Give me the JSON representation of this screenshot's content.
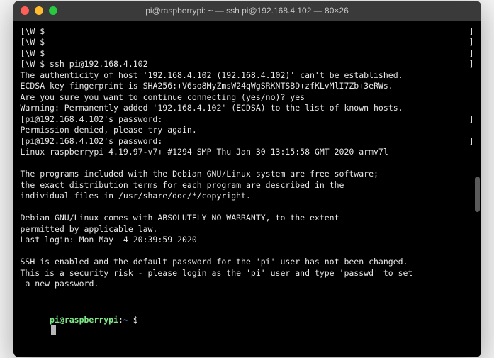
{
  "window": {
    "title": "pi@raspberrypi: ~ — ssh pi@192.168.4.102 — 80×26"
  },
  "lines": {
    "l0": "[\\W $",
    "l0r": "]",
    "l1": "[\\W $",
    "l1r": "]",
    "l2": "[\\W $",
    "l2r": "]",
    "l3": "[\\W $ ssh pi@192.168.4.102",
    "l3r": "]",
    "l4": "The authenticity of host '192.168.4.102 (192.168.4.102)' can't be established.",
    "l5": "ECDSA key fingerprint is SHA256:+V6so8MyZmsW24qWgSRKNTSBD+zfKLvMlI7Zb+3eRWs.",
    "l6": "Are you sure you want to continue connecting (yes/no)? yes",
    "l7": "Warning: Permanently added '192.168.4.102' (ECDSA) to the list of known hosts.",
    "l8": "[pi@192.168.4.102's password:",
    "l8r": "]",
    "l9": "Permission denied, please try again.",
    "l10": "[pi@192.168.4.102's password:",
    "l10r": "]",
    "l11": "Linux raspberrypi 4.19.97-v7+ #1294 SMP Thu Jan 30 13:15:58 GMT 2020 armv7l",
    "l12": "The programs included with the Debian GNU/Linux system are free software;",
    "l13": "the exact distribution terms for each program are described in the",
    "l14": "individual files in /usr/share/doc/*/copyright.",
    "l15": "Debian GNU/Linux comes with ABSOLUTELY NO WARRANTY, to the extent",
    "l16": "permitted by applicable law.",
    "l17": "Last login: Mon May  4 20:39:59 2020",
    "l18": "SSH is enabled and the default password for the 'pi' user has not been changed.",
    "l19": "This is a security risk - please login as the 'pi' user and type 'passwd' to set",
    "l20": " a new password."
  },
  "prompt": {
    "user": "pi@raspberrypi",
    "colon": ":",
    "path": "~ ",
    "dollar": "$"
  }
}
